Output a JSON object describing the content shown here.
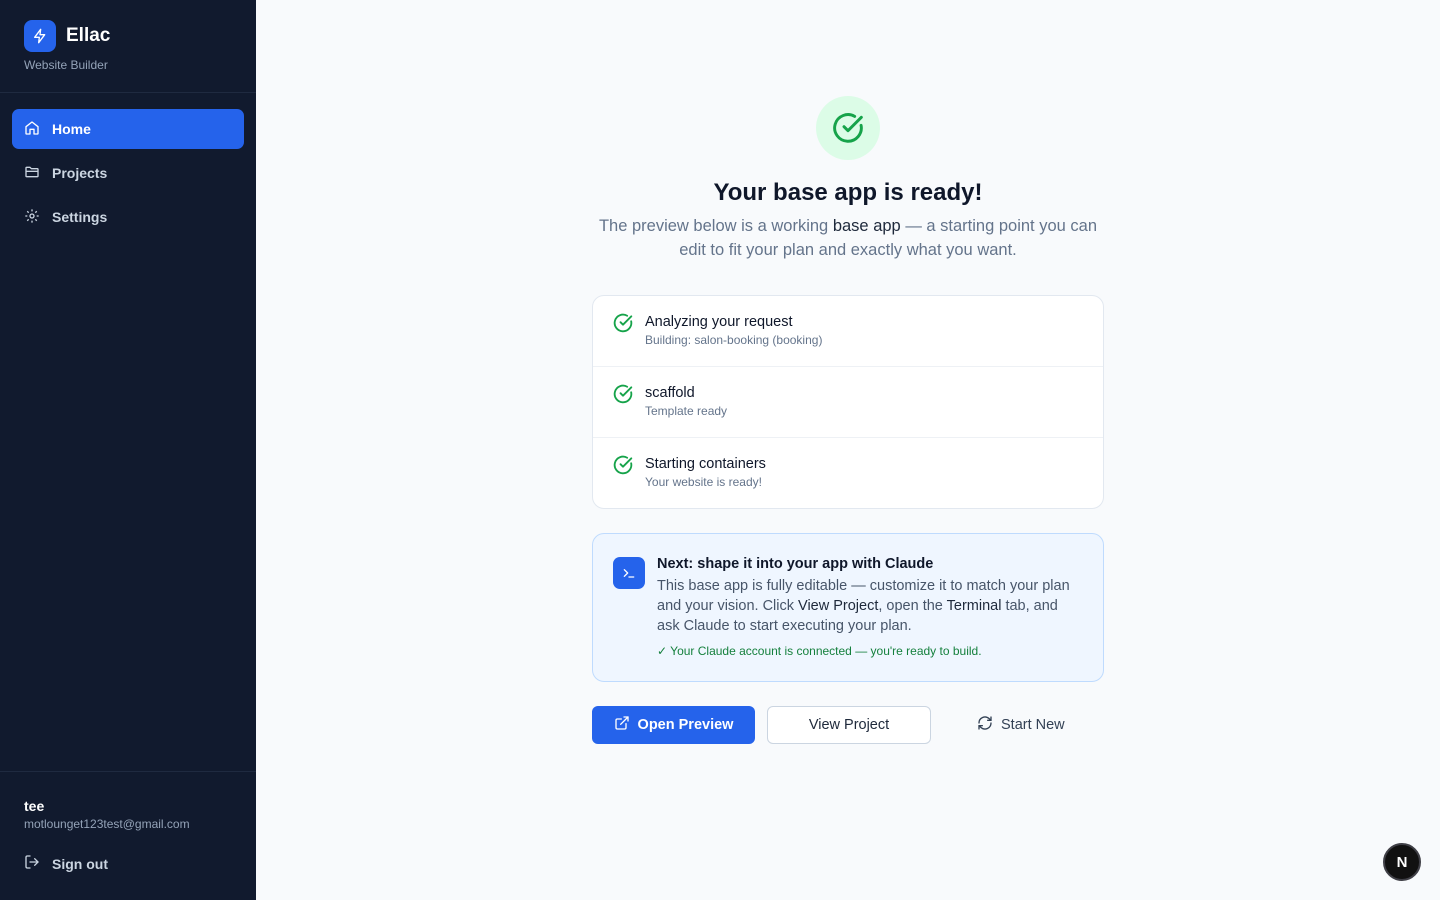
{
  "brand": {
    "name": "Ellac",
    "subtitle": "Website Builder"
  },
  "nav": [
    {
      "label": "Home",
      "icon": "home-icon",
      "active": true
    },
    {
      "label": "Projects",
      "icon": "folder-icon",
      "active": false
    },
    {
      "label": "Settings",
      "icon": "gear-icon",
      "active": false
    }
  ],
  "user": {
    "name": "tee",
    "email": "motlounget123test@gmail.com",
    "signout_label": "Sign out"
  },
  "main": {
    "title": "Your base app is ready!",
    "subtitle_pre": "The preview below is a working ",
    "subtitle_bold": "base app",
    "subtitle_post": " — a starting point you can edit to fit your plan and exactly what you want.",
    "steps": [
      {
        "title": "Analyzing your request",
        "detail": "Building: salon-booking (booking)"
      },
      {
        "title": "scaffold",
        "detail": "Template ready"
      },
      {
        "title": "Starting containers",
        "detail": "Your website is ready!"
      }
    ],
    "next": {
      "title": "Next: shape it into your app with Claude",
      "body_1": "This base app is fully editable — customize it to match your plan and your vision. Click ",
      "body_bold_1": "View Project",
      "body_2": ", open the ",
      "body_bold_2": "Terminal",
      "body_3": " tab, and ask Claude to start executing your plan.",
      "status": "✓ Your Claude account is connected — you're ready to build."
    },
    "actions": {
      "open_preview": "Open Preview",
      "view_project": "View Project",
      "start_new": "Start New"
    }
  },
  "badge": {
    "letter": "N"
  },
  "colors": {
    "sidebar": "#111a2e",
    "accent": "#2563eb",
    "success": "#16a34a",
    "success_bg": "#dcfce7"
  }
}
